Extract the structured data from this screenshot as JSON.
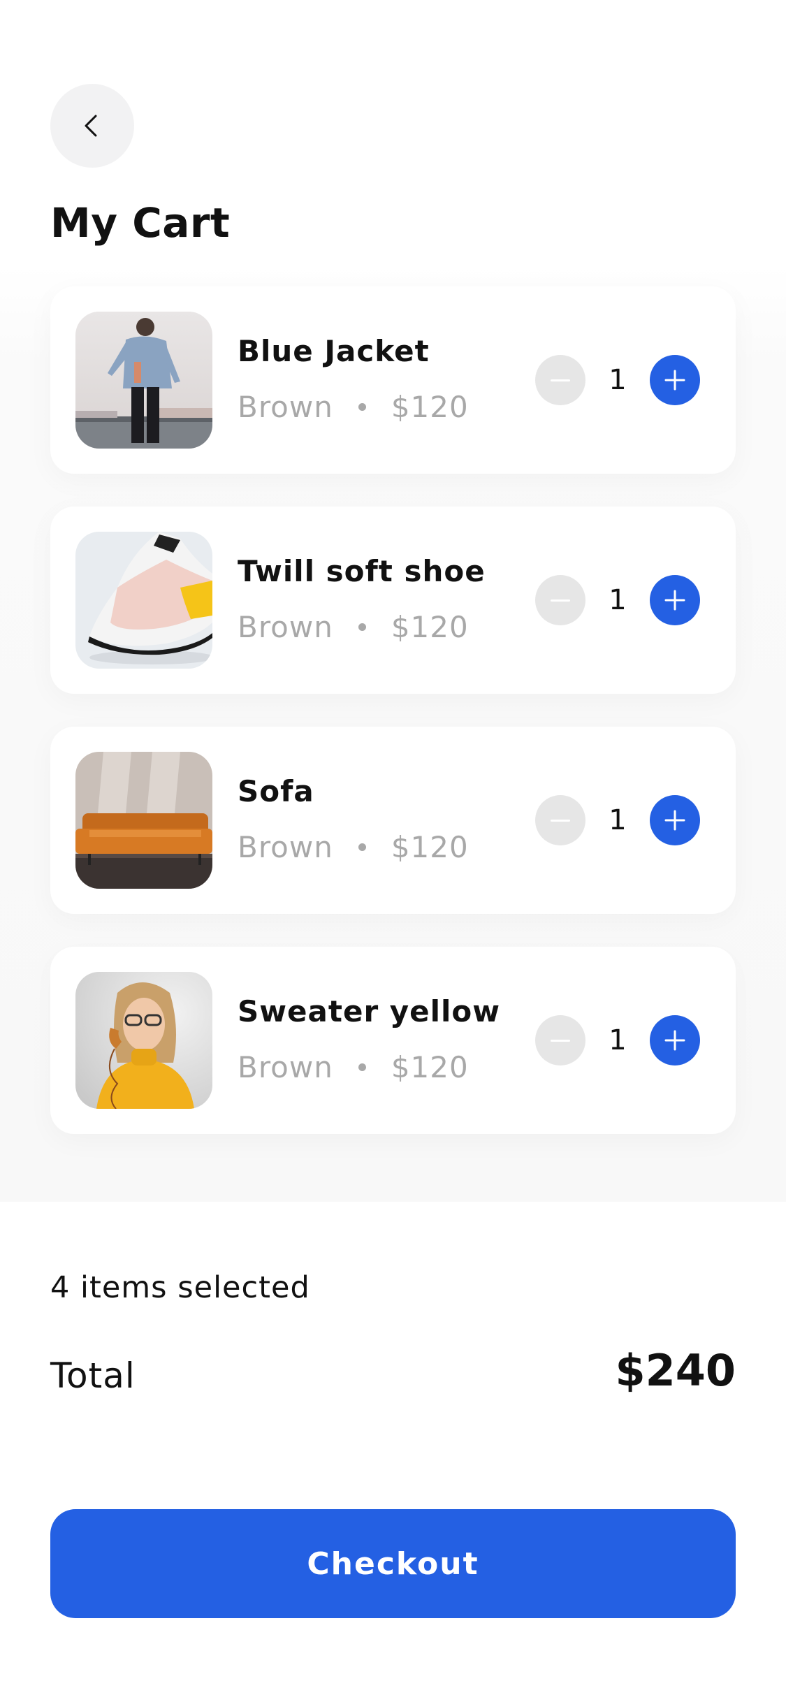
{
  "header": {
    "back_icon": "chevron-left-icon",
    "title": "My Cart"
  },
  "cart": {
    "items": [
      {
        "name": "Blue Jacket",
        "color": "Brown",
        "price": "$120",
        "quantity": "1",
        "image": "person-denim-jacket-photo"
      },
      {
        "name": "Twill soft shoe",
        "color": "Brown",
        "price": "$120",
        "quantity": "1",
        "image": "sneaker-photo"
      },
      {
        "name": "Sofa",
        "color": "Brown",
        "price": "$120",
        "quantity": "1",
        "image": "orange-leather-sofa-photo"
      },
      {
        "name": "Sweater yellow",
        "color": "Brown",
        "price": "$120",
        "quantity": "1",
        "image": "woman-yellow-sweater-phone-photo"
      }
    ],
    "minus_icon": "minus-icon",
    "plus_icon": "plus-icon"
  },
  "summary": {
    "selected_text": "4 items selected",
    "total_label": "Total",
    "total_value": "$240"
  },
  "checkout": {
    "label": "Checkout"
  },
  "colors": {
    "accent": "#2460e3",
    "minus_bg": "#e6e6e6",
    "muted_text": "#a8a8a8",
    "back_bg": "#f2f2f3"
  }
}
